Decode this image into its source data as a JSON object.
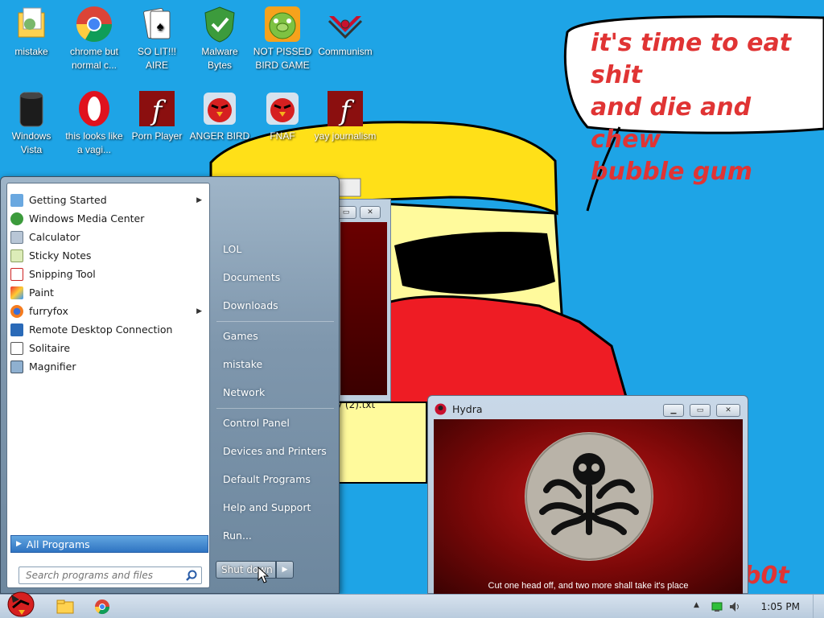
{
  "desktop": {
    "icons": [
      {
        "label": "mistake",
        "icon": "folder-icon"
      },
      {
        "label": "chrome but normal c...",
        "icon": "chrome-icon"
      },
      {
        "label": "SO LIT!!! AIRE",
        "icon": "solitaire-icon"
      },
      {
        "label": "Malware Bytes",
        "icon": "shield-icon"
      },
      {
        "label": "NOT PISSED BIRD GAME",
        "icon": "pig-icon"
      },
      {
        "label": "Communism",
        "icon": "emblem-icon"
      },
      {
        "label": "Windows Vista",
        "icon": "trash-icon"
      },
      {
        "label": "this looks like a vagi...",
        "icon": "opera-icon"
      },
      {
        "label": "Porn Player",
        "icon": "flash-icon"
      },
      {
        "label": "ANGER BIRD",
        "icon": "angry-bird-icon"
      },
      {
        "label": "FNAF",
        "icon": "angry-bird-icon"
      },
      {
        "label": "yay journalism",
        "icon": "flash-icon"
      }
    ]
  },
  "wallpaper": {
    "speech": "it's time to eat shit\nand die and chew\nbubble gum",
    "signature": "b0t",
    "file_caption": "y (2).txt"
  },
  "start_menu": {
    "programs": [
      {
        "label": "Getting Started",
        "icon": "getting-started-icon",
        "has_arrow": true
      },
      {
        "label": "Windows Media Center",
        "icon": "media-center-icon",
        "has_arrow": false
      },
      {
        "label": "Calculator",
        "icon": "calculator-icon",
        "has_arrow": false
      },
      {
        "label": "Sticky Notes",
        "icon": "sticky-notes-icon",
        "has_arrow": false
      },
      {
        "label": "Snipping Tool",
        "icon": "scissors-icon",
        "has_arrow": false
      },
      {
        "label": "Paint",
        "icon": "paint-icon",
        "has_arrow": false
      },
      {
        "label": "furryfox",
        "icon": "firefox-icon",
        "has_arrow": true
      },
      {
        "label": "Remote Desktop Connection",
        "icon": "remote-desktop-icon",
        "has_arrow": false
      },
      {
        "label": "Solitaire",
        "icon": "solitaire-icon",
        "has_arrow": false
      },
      {
        "label": "Magnifier",
        "icon": "magnifier-icon",
        "has_arrow": false
      }
    ],
    "all_programs": "All Programs",
    "search_placeholder": "Search programs and files",
    "places": [
      {
        "label": "LOL"
      },
      {
        "label": "Documents"
      },
      {
        "label": "Downloads"
      },
      {
        "label": "Games"
      },
      {
        "label": "mistake"
      },
      {
        "label": "Network"
      },
      {
        "label": "Control Panel"
      },
      {
        "label": "Devices and Printers"
      },
      {
        "label": "Default Programs"
      },
      {
        "label": "Help and Support"
      },
      {
        "label": "Run..."
      }
    ],
    "shutdown_label": "Shut down"
  },
  "hydra_window": {
    "title": "Hydra",
    "caption": "Cut one head off, and two more shall take it's place"
  },
  "taskbar": {
    "clock": "1:05 PM",
    "pinned": [
      "start-orb-icon",
      "explorer-icon",
      "chrome-icon"
    ]
  },
  "colors": {
    "desktop_bg": "#1ea4e6",
    "speech_text": "#e03434",
    "all_programs_highlight": "#2f74c2"
  }
}
